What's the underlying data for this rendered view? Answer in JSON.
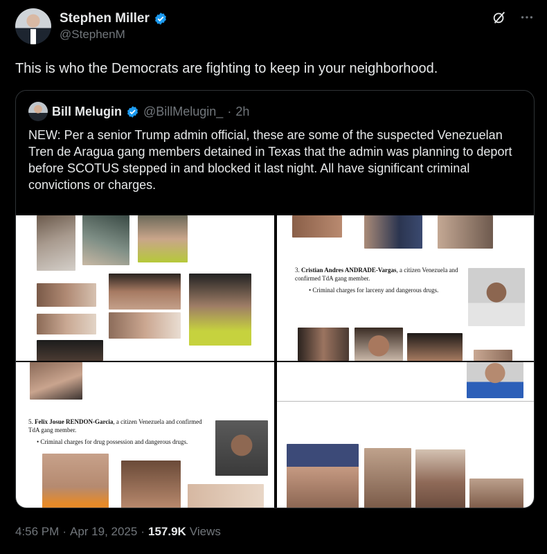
{
  "author": {
    "name": "Stephen Miller",
    "handle": "@StephenM"
  },
  "tweet": {
    "text": "This is who the Democrats are fighting to keep in your neighborhood."
  },
  "quote": {
    "name": "Bill Melugin",
    "handle": "@BillMelugin_",
    "separator": "·",
    "time": "2h",
    "text": "NEW: Per a senior Trump admin official, these are some of the suspected Venezuelan Tren de Aragua gang members detained in Texas that the admin was planning to deport before SCOTUS stepped in and blocked it last night. All have significant criminal convictions or charges."
  },
  "documents": {
    "entry3_number": "3.",
    "entry3_name": "Cristian Andres ANDRADE-Vargas",
    "entry3_rest": ", a citizen  Venezuela and",
    "entry3_line2": "confirmed TdA gang member.",
    "entry3_bullet": "Criminal charges for larceny and dangerous drugs.",
    "entry5_number": "5.",
    "entry5_name": "Felix Josue RENDON-Garcia",
    "entry5_rest": ", a citizen  Venezuela and confirmed",
    "entry5_line2": "TdA gang member.",
    "entry5_bullet": "Criminal charges for drug possession and dangerous drugs."
  },
  "footer": {
    "time": "4:56 PM",
    "dot1": "·",
    "date": "Apr 19, 2025",
    "dot2": "·",
    "views_count": "157.9K",
    "views_label": "Views"
  },
  "icons": {
    "verified": "verified-badge-icon",
    "grok": "grok-icon",
    "more": "more-icon"
  },
  "colors": {
    "background": "#000000",
    "text": "#e7e9ea",
    "secondary": "#71767b",
    "verified": "#1d9bf0",
    "border": "#2f3336"
  }
}
